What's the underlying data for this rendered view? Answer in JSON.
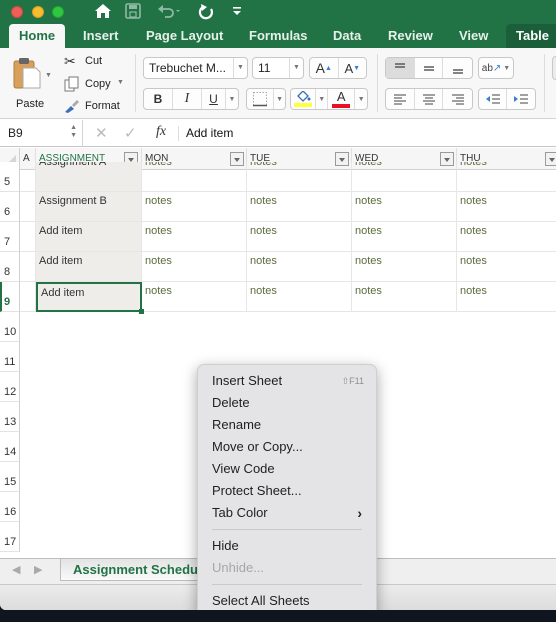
{
  "window": {
    "quick_access": {
      "home_icon": "home-icon",
      "save_icon": "save-icon",
      "undo_icon": "undo-icon",
      "redo_icon": "redo-icon",
      "customize_icon": "customize-toolbar-icon"
    },
    "tabs": [
      {
        "label": "Home",
        "active": true
      },
      {
        "label": "Insert"
      },
      {
        "label": "Page Layout"
      },
      {
        "label": "Formulas"
      },
      {
        "label": "Data"
      },
      {
        "label": "Review"
      },
      {
        "label": "View"
      },
      {
        "label": "Table",
        "contextual": true
      }
    ]
  },
  "ribbon": {
    "paste_label": "Paste",
    "cut_label": "Cut",
    "copy_label": "Copy",
    "format_label": "Format",
    "font_name": "Trebuchet M...",
    "font_size": "11",
    "bold": "B",
    "italic": "I",
    "underline": "U",
    "increase_font": "A",
    "decrease_font": "A",
    "font_color_hex": "#e81123",
    "fill_color_hex": "#ffff3b"
  },
  "formula_bar": {
    "name_box": "B9",
    "fx": "fx",
    "value": "Add item"
  },
  "grid": {
    "col_a": "A",
    "headers": [
      "ASSIGNMENT",
      "MON",
      "TUE",
      "WED",
      "THU"
    ],
    "rows": [
      {
        "num": "5",
        "assignment": "Assignment A",
        "notes": [
          "notes",
          "notes",
          "notes",
          "notes"
        ]
      },
      {
        "num": "6",
        "assignment": "Assignment B",
        "notes": [
          "notes",
          "notes",
          "notes",
          "notes"
        ]
      },
      {
        "num": "7",
        "assignment": "Add item",
        "notes": [
          "notes",
          "notes",
          "notes",
          "notes"
        ]
      },
      {
        "num": "8",
        "assignment": "Add item",
        "notes": [
          "notes",
          "notes",
          "notes",
          "notes"
        ]
      },
      {
        "num": "9",
        "assignment": "Add item",
        "notes": [
          "notes",
          "notes",
          "notes",
          "notes"
        ]
      }
    ],
    "empty_rows": [
      "10",
      "11",
      "12",
      "13",
      "14",
      "15",
      "16",
      "17"
    ],
    "selected_cell": "B9",
    "accent": "#217346"
  },
  "sheet_tabs": {
    "active": "Assignment Schedule",
    "prev_icon": "scroll-left-icon",
    "next_icon": "scroll-right-icon"
  },
  "context_menu": {
    "items": [
      {
        "label": "Insert Sheet",
        "shortcut": "⇧F11"
      },
      {
        "label": "Delete"
      },
      {
        "label": "Rename"
      },
      {
        "label": "Move or Copy..."
      },
      {
        "label": "View Code"
      },
      {
        "label": "Protect Sheet..."
      },
      {
        "label": "Tab Color",
        "submenu": true
      },
      {
        "label": "Hide"
      },
      {
        "label": "Unhide...",
        "disabled": true
      },
      {
        "label": "Select All Sheets"
      }
    ]
  }
}
